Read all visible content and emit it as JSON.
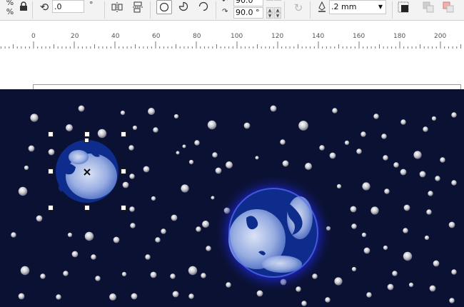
{
  "toolbar": {
    "percent_symbol_top": "%",
    "percent_symbol_bottom": "%",
    "lock_icon": "lock-icon",
    "rotation_value": ".0",
    "rotation_unit": "°",
    "mirror_h_icon": "mirror-horizontal-icon",
    "mirror_v_icon": "mirror-vertical-icon",
    "align_icon": "align-icon",
    "shape_ellipse_icon": "ellipse-icon",
    "shape_pie_icon": "pie-icon",
    "shape_arc_icon": "arc-icon",
    "start_angle": "90.0",
    "end_angle": "90.0 °",
    "direction_icon": "direction-toggle-icon",
    "outline_icon": "pen-outline-icon",
    "outline_width": ".2 mm",
    "wrap_text_icon": "wrap-text-icon",
    "to_front_icon": "to-front-icon",
    "to_back_icon": "to-back-icon"
  },
  "ruler": {
    "labels": [
      "0",
      "20",
      "40",
      "60",
      "80",
      "100",
      "120",
      "140",
      "160",
      "180",
      "200"
    ]
  },
  "colors": {
    "night_sky": "#0b1133",
    "planet_dark": "#0f2d8a",
    "planet_light": "#c8d6f2",
    "glow": "#2e3fff"
  }
}
